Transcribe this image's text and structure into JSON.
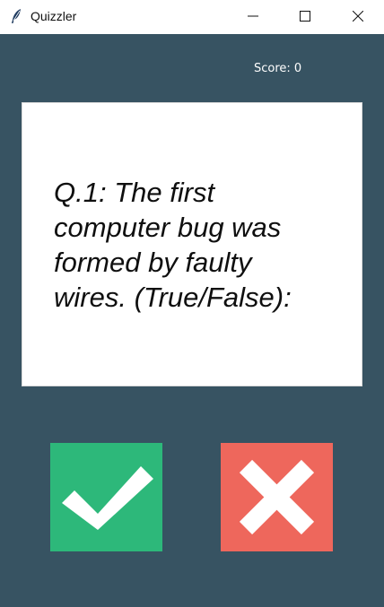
{
  "window": {
    "title": "Quizzler",
    "icon": "feather-icon",
    "controls": [
      "minimize-icon",
      "maximize-icon",
      "close-icon"
    ]
  },
  "score": {
    "text": "Score: 0"
  },
  "question": {
    "text": "Q.1: The first computer bug was formed by faulty wires. (True/False):"
  },
  "buttons": {
    "true_icon": "check-icon",
    "false_icon": "x-icon"
  },
  "colors": {
    "background": "#375362",
    "card": "#ffffff",
    "true_button": "#2db87a",
    "false_button": "#ee675c"
  }
}
